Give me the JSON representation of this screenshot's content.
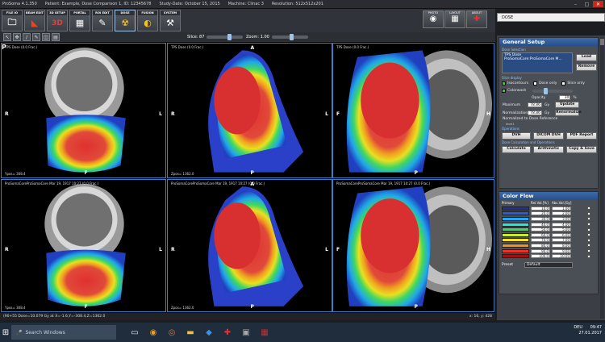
{
  "window": {
    "title": "ProSoma 4.1.350",
    "patient": "Patient: Example, Dose Comparison 1, ID: 12345678",
    "study": "Study-Date: October 15, 2015",
    "machine": "Machine: Clinac 3",
    "resolution": "Resolution: 512x512x201"
  },
  "toolbar": {
    "buttons": [
      "FILE IO",
      "BEAM EDIT",
      "3D SETUP",
      "PORTAL",
      "ROI EDIT",
      "DOSE",
      "FUSION",
      "SYSTEM"
    ],
    "right_buttons": [
      "PHOTO",
      "LAYOUT",
      "ABOUT"
    ]
  },
  "toolbar2": {
    "slice_label": "Slice: 87",
    "zoom_label": "Zoom: 1.00"
  },
  "viewports": [
    {
      "header": "TPS Dose (0.0 Frac.)",
      "footer": "Ypos= 308.4",
      "left": "R",
      "right": "L",
      "top": "",
      "bottom": "F",
      "extra": "P"
    },
    {
      "header": "TPS Dose (0.0 Frac.)",
      "footer": "Zpos= 1362.0",
      "left": "R",
      "right": "L",
      "top": "A",
      "bottom": "P"
    },
    {
      "header": "TPS Dose (0.0 Frac.)",
      "footer": "",
      "left": "F",
      "right": "H",
      "top": "",
      "bottom": "P"
    },
    {
      "header": "ProSomaCoreProSomaCore Mar 19, 1917 10:27 (0.0 Frac.)",
      "footer": "Ypos= 308.4",
      "left": "R",
      "right": "L",
      "top": "",
      "bottom": "F"
    },
    {
      "header": "ProSomaCoreProSomaCore Mar 19, 1917 10:27 (0.0 Frac.)",
      "footer": "Zpos= 1362.0",
      "left": "R",
      "right": "L",
      "top": "A",
      "bottom": "P"
    },
    {
      "header": "ProSomaCoreProSomaCore Mar 19, 1917 10:27 (0.0 Frac.)",
      "footer": "",
      "left": "F",
      "right": "H",
      "top": "",
      "bottom": "P"
    }
  ],
  "statusbar": {
    "left": "(90+55 Dose=10.079 Gy at X=-1.6,Y=-308.4,Z=1362.0",
    "right": "x: 16, y: 428"
  },
  "right_panel": {
    "dose_tab": "DOSE",
    "general_setup": "General Setup",
    "dose_selection": "Dose Selection",
    "dose_list": [
      "TPS Dose",
      "ProSomaCore:ProSomaCore M..."
    ],
    "load": "Load",
    "remove": "Remove",
    "slice_display": "Slice display",
    "isocontours": "Isocontours",
    "dose_only": "Dose only",
    "slice_only": "Slice only",
    "colorwash": "Colorwash",
    "opacity_label": "Opacity",
    "opacity_value": "30",
    "opacity_unit": "%",
    "max_label": "Maximum",
    "max_value": "78.86",
    "max_unit": "Gy",
    "update": "Update",
    "norm_label": "Normalization",
    "norm_value": "78.86",
    "norm_unit": "Gy",
    "renormalize": "Renormalize",
    "norm_ref": "Normalized to Dose Reference",
    "norm_small": "level1",
    "operations": "Operations",
    "dvh": "DVH",
    "dicom_dvh": "DICOM DVH",
    "pdf_report": "PDF Report",
    "dose_calc": "Dose Calculation and Operations",
    "calculate": "Calculate",
    "arithmetic": "Arithmetic",
    "copy_save": "Copy & Save",
    "color_flow": "Color Flow",
    "cf_headers": [
      "Primary",
      "Rel.Val.[%]",
      "Abs.Val.[Gy]"
    ],
    "preset_label": "Preset",
    "preset_value": "Default"
  },
  "color_flow_rows": [
    {
      "rel": "10.0",
      "abs": "1.00",
      "color": "#2030a0"
    },
    {
      "rel": "20.0",
      "abs": "2.00",
      "color": "#2060e0"
    },
    {
      "rel": "30.0",
      "abs": "3.00",
      "color": "#20a8ff"
    },
    {
      "rel": "40.0",
      "abs": "4.00",
      "color": "#20e8e8"
    },
    {
      "rel": "50.0",
      "abs": "5.00",
      "color": "#30e060"
    },
    {
      "rel": "60.0",
      "abs": "6.00",
      "color": "#c8f020"
    },
    {
      "rel": "70.0",
      "abs": "7.00",
      "color": "#f8e020"
    },
    {
      "rel": "80.0",
      "abs": "8.00",
      "color": "#f89020"
    },
    {
      "rel": "90.0",
      "abs": "9.00",
      "color": "#f03020"
    },
    {
      "rel": "100.0",
      "abs": "10.00",
      "color": "#a01010"
    }
  ],
  "taskbar": {
    "search_placeholder": "Search Windows",
    "time": "09:47",
    "date": "27.01.2017",
    "lang": "DEU"
  }
}
